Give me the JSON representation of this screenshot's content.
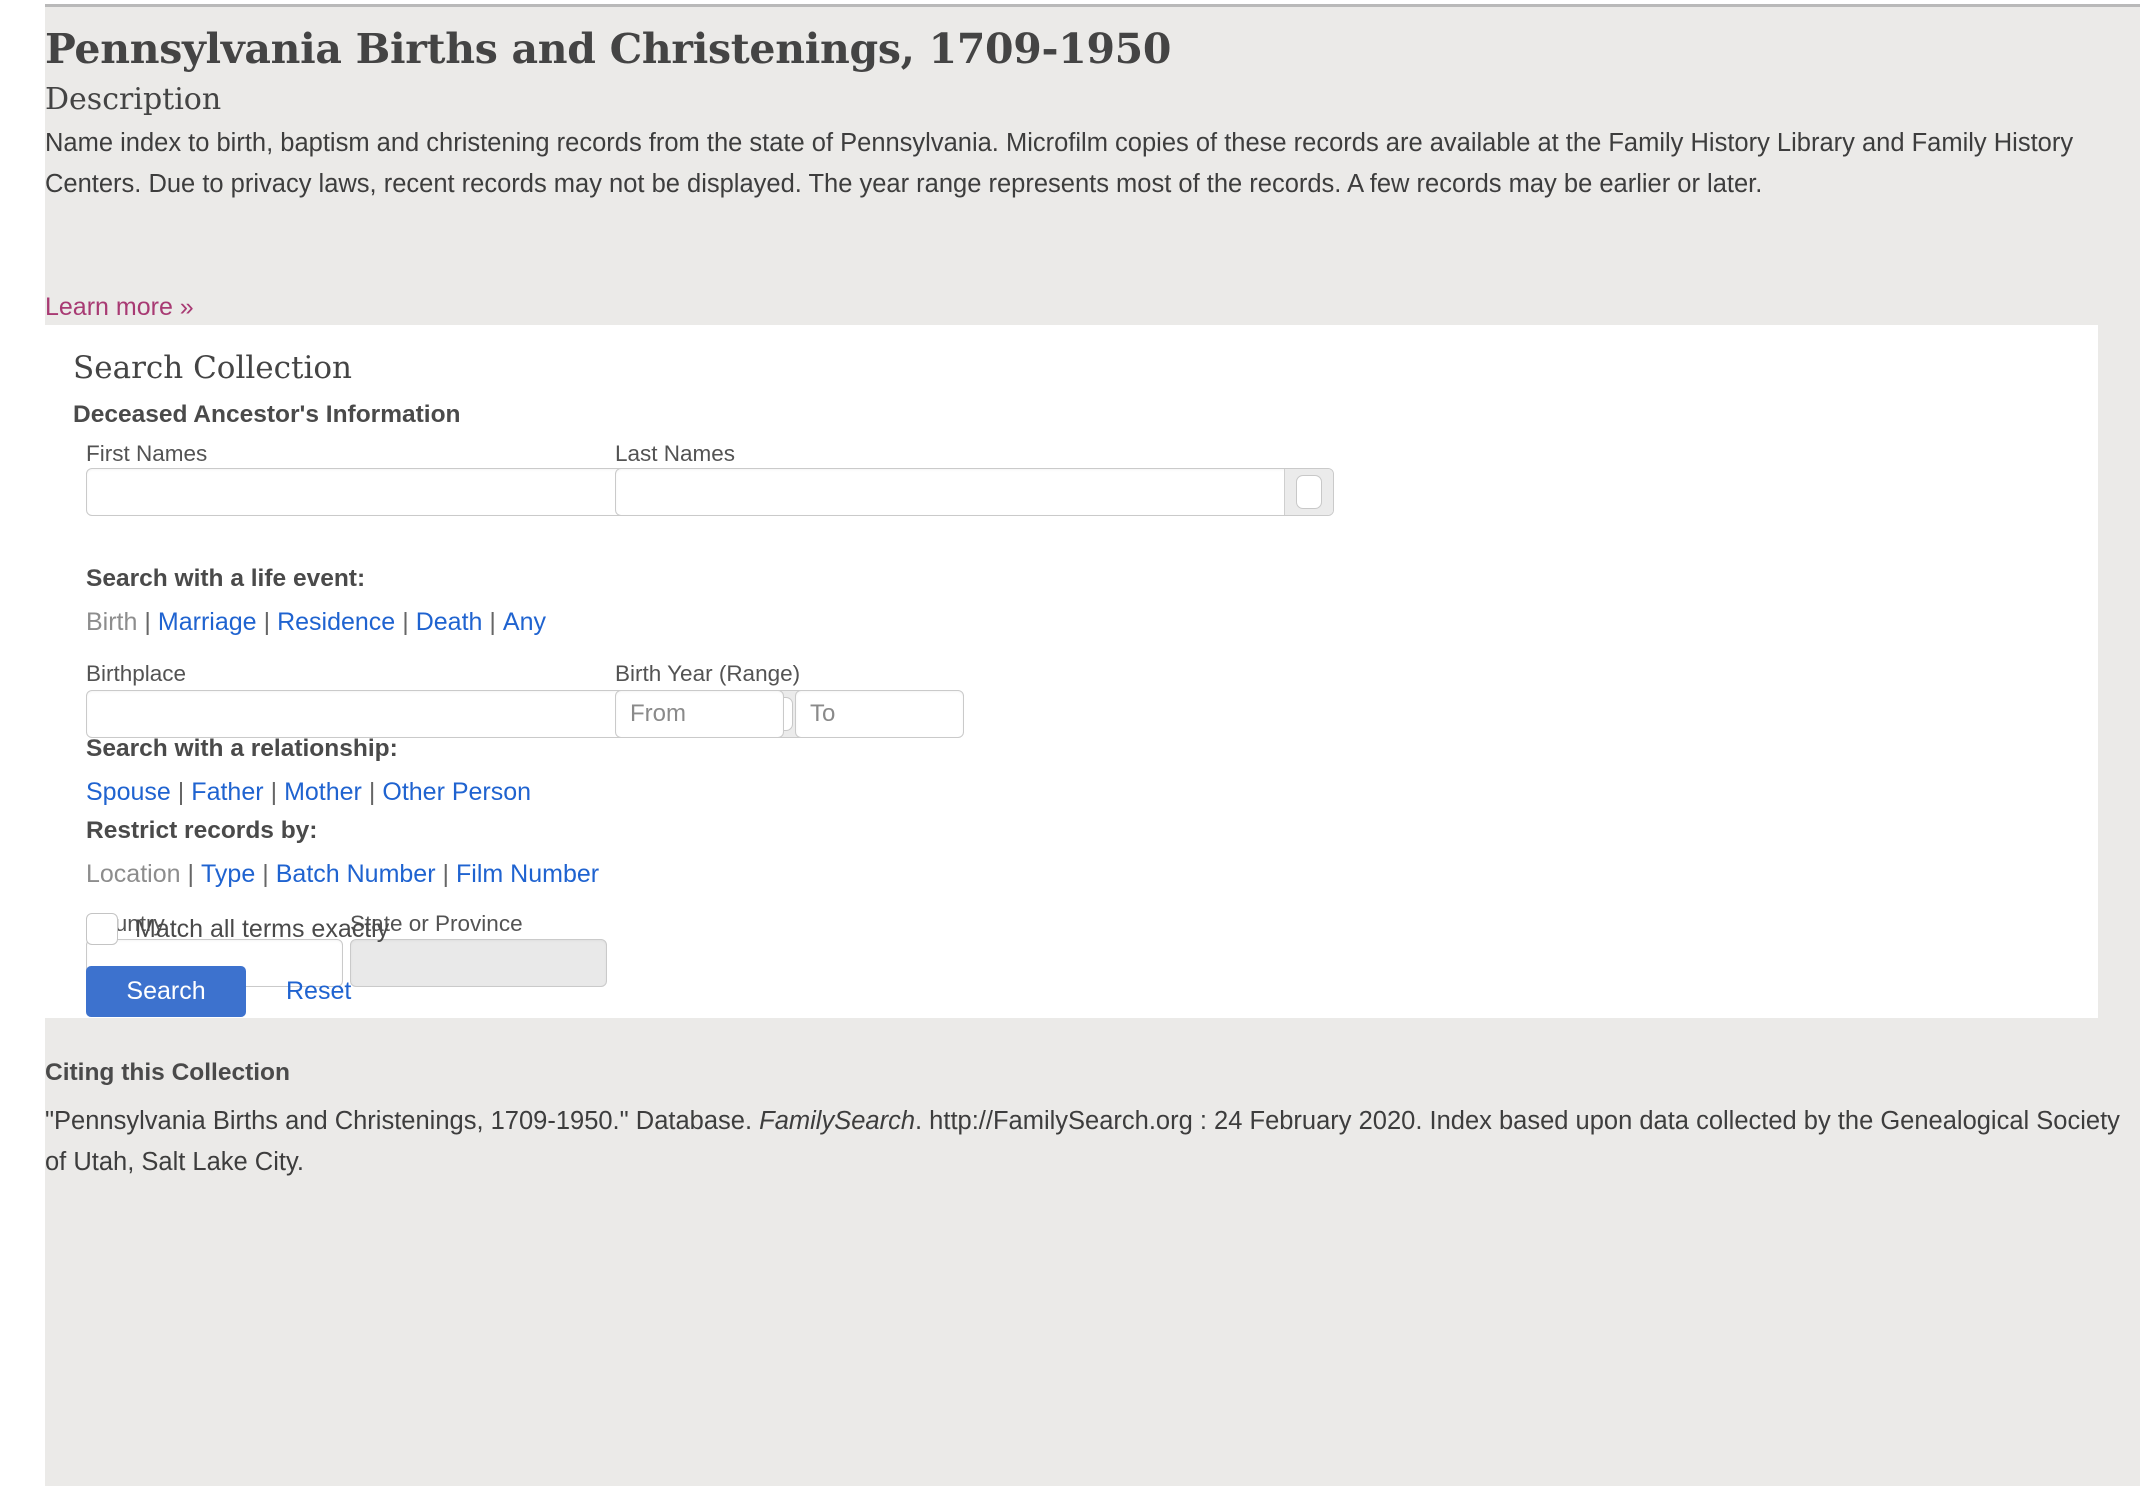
{
  "header": {
    "title": "Pennsylvania Births and Christenings, 1709-1950",
    "description_heading": "Description",
    "description_body": "Name index to birth, baptism and christening records from the state of Pennsylvania. Microfilm copies of these records are available at the Family History Library and Family History Centers. Due to privacy laws, recent records may not be displayed. The year range represents most of the records. A few records may be earlier or later.",
    "learn_more": "Learn more »"
  },
  "search": {
    "title": "Search Collection",
    "ancestor_section": "Deceased Ancestor's Information",
    "first_names_label": "First Names",
    "first_names_value": "",
    "last_names_label": "Last Names",
    "last_names_value": "",
    "life_event_section": "Search with a life event:",
    "life_event_links": [
      {
        "label": "Birth",
        "active": true
      },
      {
        "label": "Marriage",
        "active": false
      },
      {
        "label": "Residence",
        "active": false
      },
      {
        "label": "Death",
        "active": false
      },
      {
        "label": "Any",
        "active": false
      }
    ],
    "birthplace_label": "Birthplace",
    "birthplace_value": "",
    "birth_year_label": "Birth Year (Range)",
    "birth_year_from_placeholder": "From",
    "birth_year_from_value": "",
    "birth_year_to_placeholder": "To",
    "birth_year_to_value": "",
    "relationship_section": "Search with a relationship:",
    "relationship_links": [
      {
        "label": "Spouse",
        "active": false
      },
      {
        "label": "Father",
        "active": false
      },
      {
        "label": "Mother",
        "active": false
      },
      {
        "label": "Other Person",
        "active": false
      }
    ],
    "restrict_section": "Restrict records by:",
    "restrict_links": [
      {
        "label": "Location",
        "active": true
      },
      {
        "label": "Type",
        "active": false
      },
      {
        "label": "Batch Number",
        "active": false
      },
      {
        "label": "Film Number",
        "active": false
      }
    ],
    "country_label": "Country",
    "country_value": "",
    "state_label": "State or Province",
    "state_value": "",
    "match_all_label": "Match all terms exactly",
    "match_all_checked": false,
    "search_button": "Search",
    "reset_button": "Reset",
    "separator": "|"
  },
  "citing": {
    "heading": "Citing this Collection",
    "text_before_italic": "\"Pennsylvania Births and Christenings, 1709-1950.\" Database. ",
    "italic_text": "FamilySearch",
    "text_after_italic": ". http://FamilySearch.org : 24 February 2020. Index based upon data collected by the Genealogical Society of Utah, Salt Lake City."
  },
  "colors": {
    "page_background": "#ebeae8",
    "card_background": "#ffffff",
    "link_blue": "#1f63d0",
    "learn_more_magenta": "#a83a73",
    "button_blue": "#3d72ce",
    "active_link_grey": "#8d8d8d",
    "text_dark": "#3d3d3d"
  }
}
